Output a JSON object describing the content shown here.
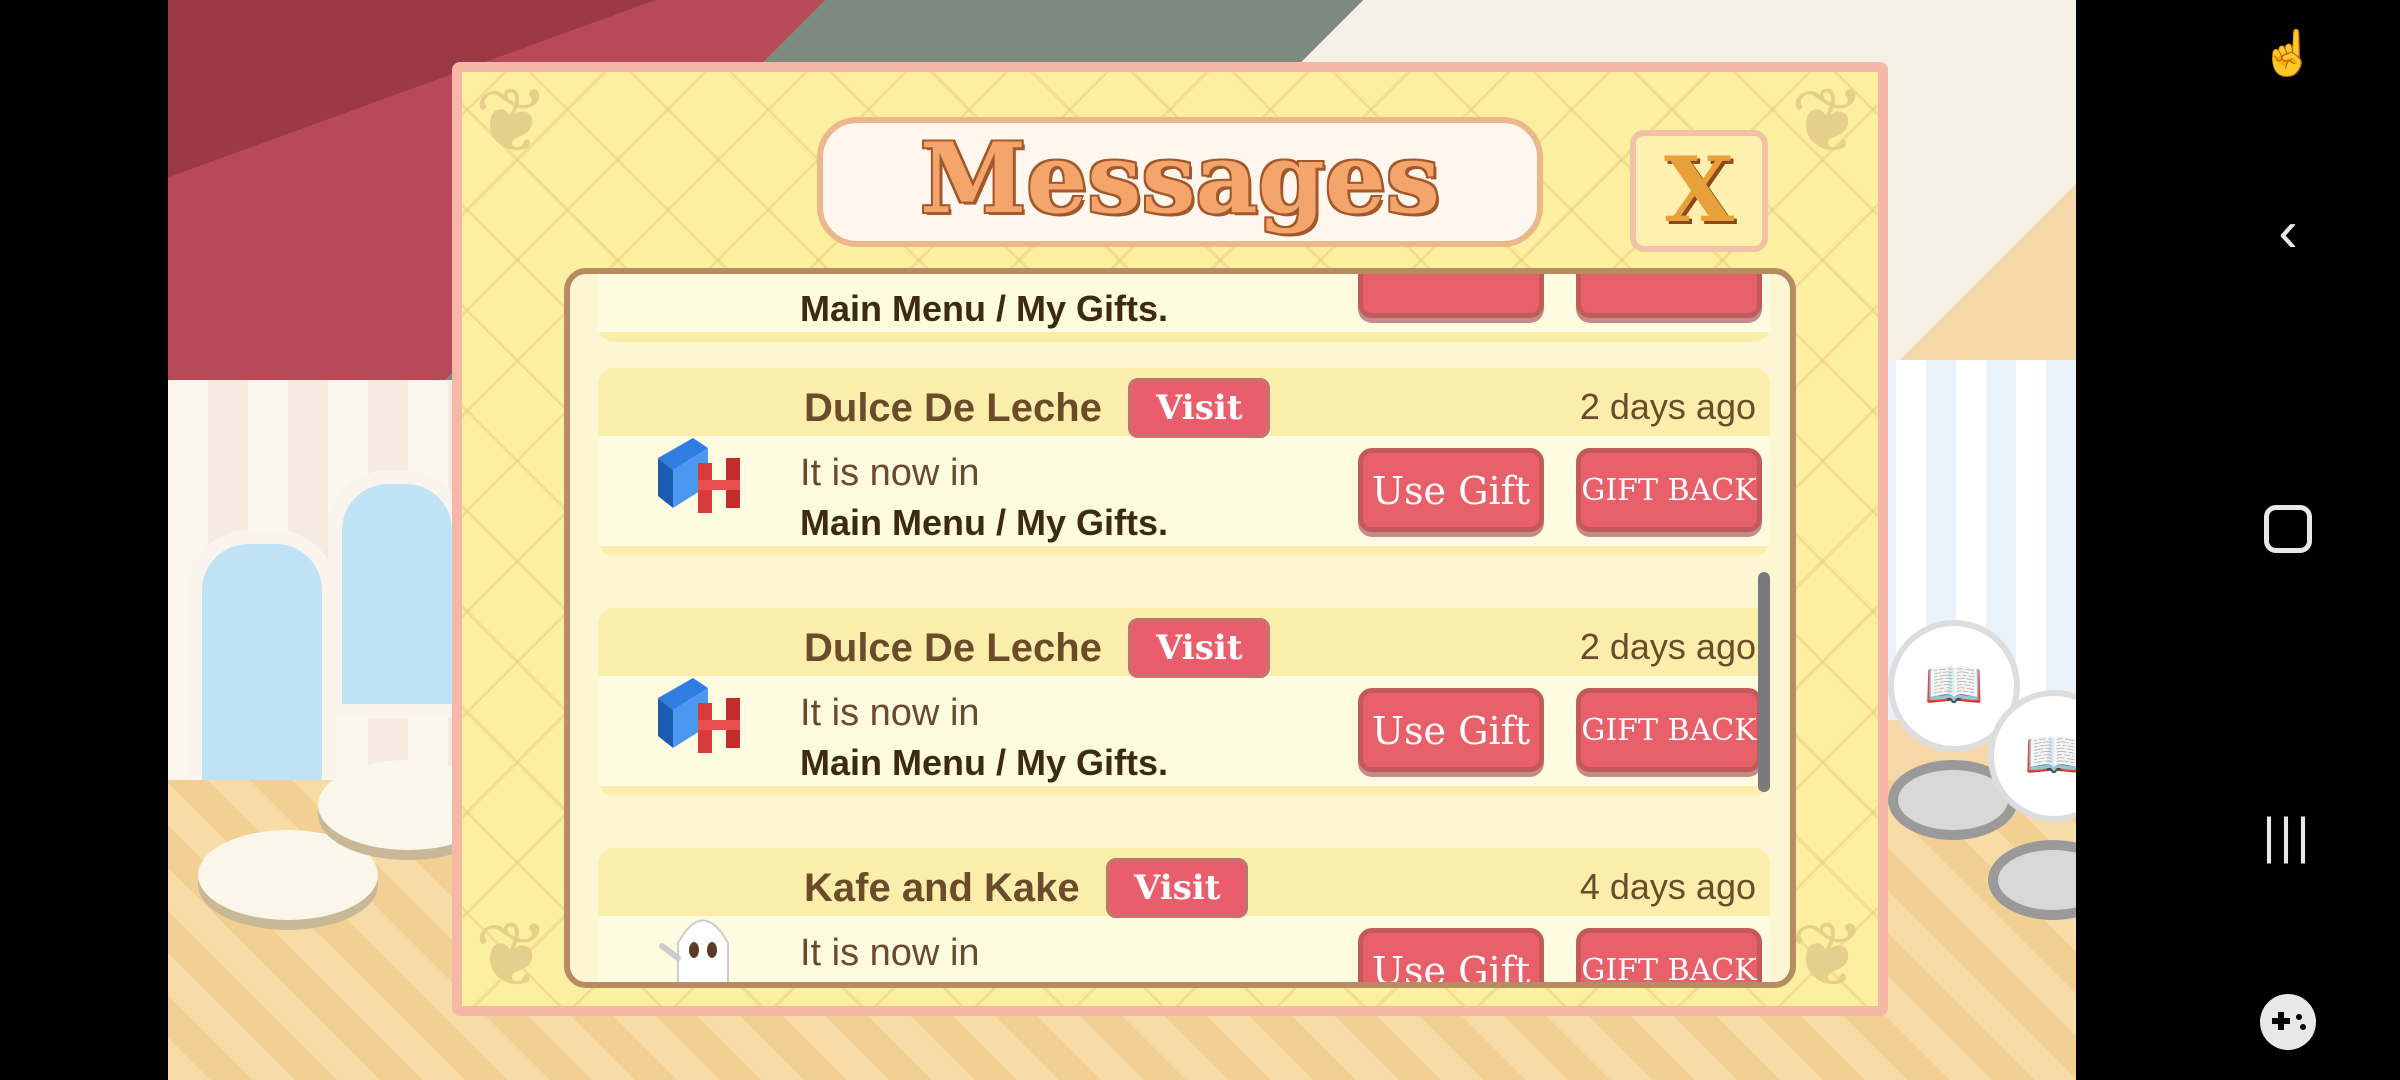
{
  "dialog": {
    "title": "Messages",
    "close_label": "X"
  },
  "partial_top_row": {
    "line2": "Main Menu / My Gifts."
  },
  "messages": [
    {
      "sender": "Dulce De Leche",
      "visit_label": "Visit",
      "time": "2 days ago",
      "line1": "It is now in",
      "line2": "Main Menu / My Gifts.",
      "use_label": "Use Gift",
      "back_label": "GIFT BACK",
      "icon": "blue-red-furniture-gift-icon"
    },
    {
      "sender": "Dulce De Leche",
      "visit_label": "Visit",
      "time": "2 days ago",
      "line1": "It is now in",
      "line2": "Main Menu / My Gifts.",
      "use_label": "Use Gift",
      "back_label": "GIFT BACK",
      "icon": "blue-red-furniture-gift-icon"
    },
    {
      "sender": "Kafe and Kake",
      "visit_label": "Visit",
      "time": "4 days ago",
      "line1": "It is now in",
      "use_label": "Use Gift",
      "back_label": "GIFT BACK",
      "icon": "ghost-gift-icon"
    }
  ],
  "system_nav": {
    "icons": [
      "screen-touch-icon",
      "back-chevron-icon",
      "home-square-icon",
      "recents-icon",
      "game-tools-icon"
    ]
  },
  "colors": {
    "dialog_bg": "#fcef9f",
    "button_red": "#e8616a",
    "text_brown": "#6a4b2a"
  }
}
